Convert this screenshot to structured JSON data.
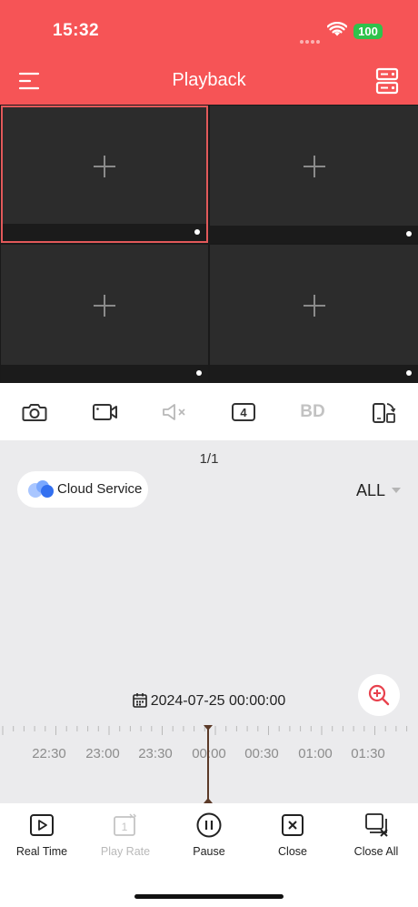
{
  "status": {
    "time": "15:32",
    "battery": "100"
  },
  "nav": {
    "title": "Playback"
  },
  "toolbar": {
    "bd_label": "BD",
    "split_count": "4"
  },
  "list": {
    "pager": "1/1",
    "cloud_label": "Cloud Service",
    "filter": "ALL",
    "date": "2024-07-25 00:00:00"
  },
  "timeline": {
    "labels": [
      "22:30",
      "23:00",
      "23:30",
      "00:00",
      "00:30",
      "01:00",
      "01:30"
    ]
  },
  "bottom": {
    "real_time": "Real Time",
    "play_rate": "Play Rate",
    "play_rate_value": "1",
    "pause": "Pause",
    "close": "Close",
    "close_all": "Close All"
  },
  "colors": {
    "accent": "#f65456",
    "cell_bg": "#2c2c2c",
    "selected_border": "#e2595a",
    "cursor": "#5b3a28"
  }
}
